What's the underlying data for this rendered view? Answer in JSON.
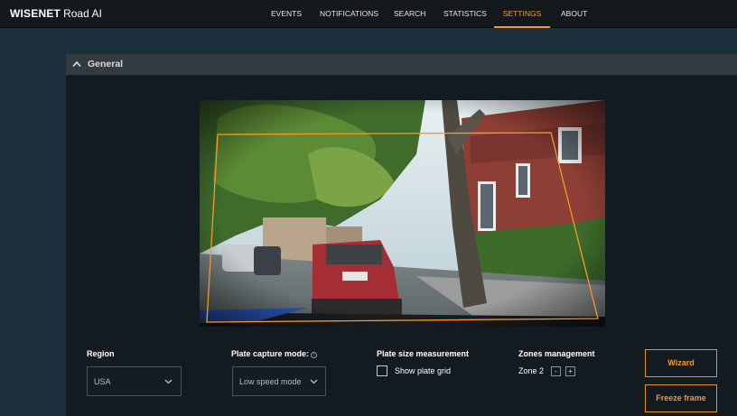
{
  "app": {
    "brand": "WISENET",
    "product": "Road AI"
  },
  "nav": {
    "items": [
      {
        "label": "EVENTS",
        "active": false
      },
      {
        "label": "NOTIFICATIONS",
        "active": false
      },
      {
        "label": "SEARCH",
        "active": false
      },
      {
        "label": "STATISTICS",
        "active": false
      },
      {
        "label": "SETTINGS",
        "active": true
      },
      {
        "label": "ABOUT",
        "active": false
      }
    ]
  },
  "section": {
    "title": "General",
    "icon": "chevron-up-icon"
  },
  "controls": {
    "region": {
      "label": "Region",
      "value": "USA"
    },
    "capture_mode": {
      "label": "Plate capture mode:",
      "value": "Low speed mode",
      "info_icon": "info-icon"
    },
    "plate_size": {
      "label": "Plate size measurement",
      "checkbox_label": "Show plate grid",
      "checked": false
    },
    "zones": {
      "label": "Zones management",
      "zone_name": "Zone 2",
      "minus": "-",
      "plus": "+"
    }
  },
  "actions": {
    "wizard": "Wizard",
    "freeze": "Freeze frame"
  },
  "colors": {
    "accent": "#f39a2a",
    "background": "#1d2f3b",
    "panel": "#141b20",
    "header": "#343b40",
    "zone_outline": "#f39a2a"
  }
}
